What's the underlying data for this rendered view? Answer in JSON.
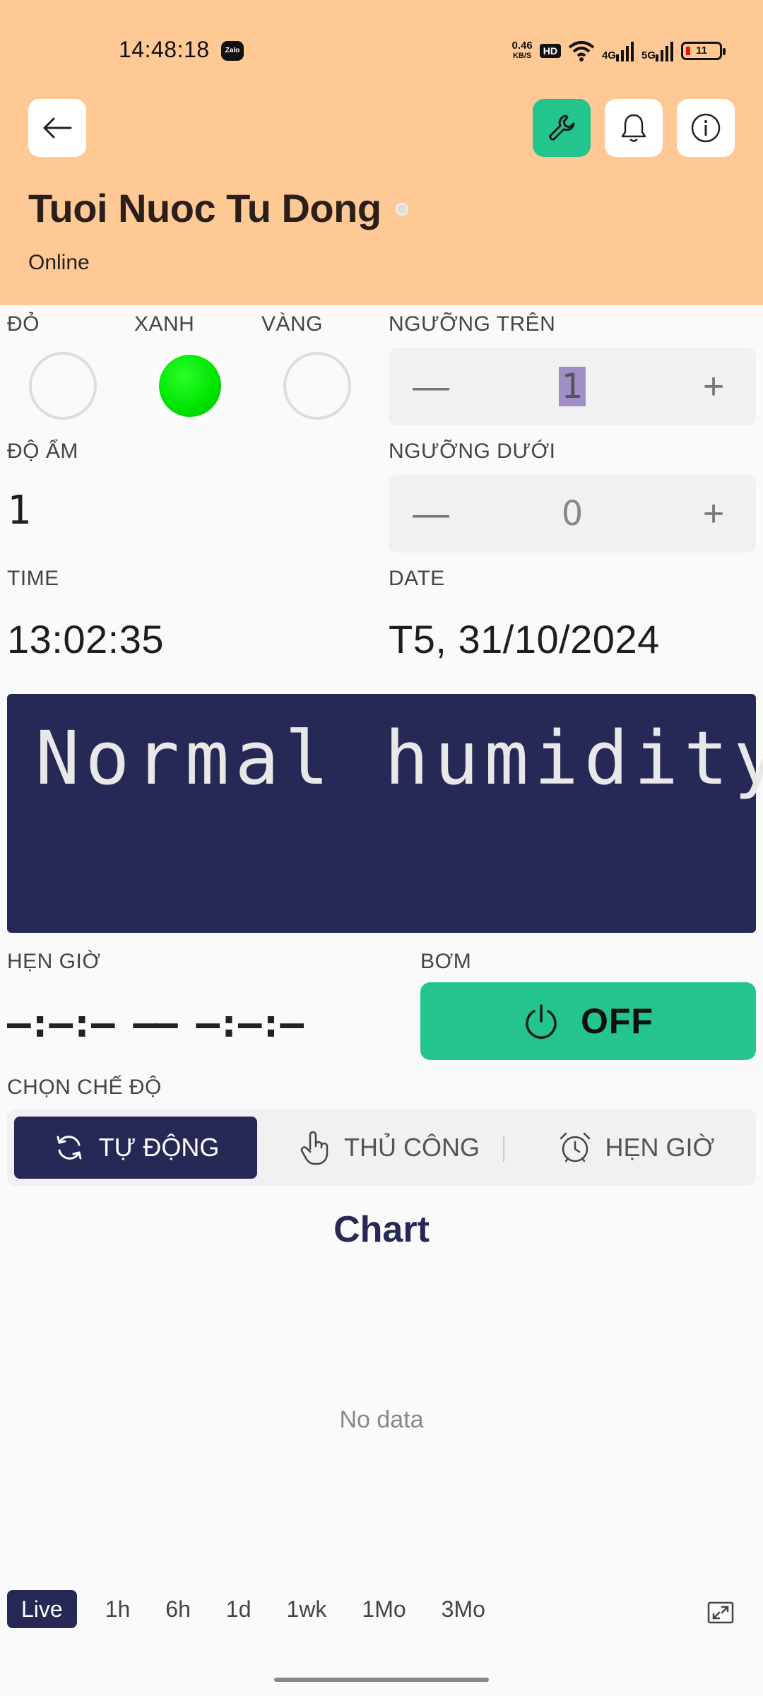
{
  "status_bar": {
    "time": "14:48:18",
    "net_speed_value": "0.46",
    "net_speed_unit": "KB/S",
    "hd_badge": "HD",
    "sig1": "4G",
    "sig2": "5G",
    "battery": "11"
  },
  "header": {
    "title": "Tuoi Nuoc Tu Dong",
    "status": "Online",
    "bg_color": "#ffc995",
    "accent_color": "#23c48e"
  },
  "leds": {
    "red_label": "ĐỎ",
    "green_label": "XANH",
    "yellow_label": "VÀNG",
    "active": "green"
  },
  "upper_threshold": {
    "label": "NGƯỠNG TRÊN",
    "value": "1",
    "minus": "—",
    "plus": "+"
  },
  "humidity": {
    "label": "ĐỘ ẨM",
    "value": "1"
  },
  "lower_threshold": {
    "label": "NGƯỠNG DƯỚI",
    "value": "0",
    "minus": "—",
    "plus": "+"
  },
  "time_widget": {
    "label": "TIME",
    "value": "13:02:35"
  },
  "date_widget": {
    "label": "DATE",
    "value": "T5, 31/10/2024"
  },
  "lcd": {
    "line1": "Normal humidity",
    "bg_color": "#262856"
  },
  "timer": {
    "label": "HẸN GIỜ",
    "value": "–:–:– –– –:–:–"
  },
  "pump": {
    "label": "BƠM",
    "button_label": "OFF"
  },
  "mode": {
    "label": "CHỌN CHẾ ĐỘ",
    "options": [
      "TỰ ĐỘNG",
      "THỦ CÔNG",
      "HẸN GIỜ"
    ],
    "selected": "TỰ ĐỘNG"
  },
  "chart": {
    "title": "Chart",
    "empty_text": "No data",
    "ranges": [
      "Live",
      "1h",
      "6h",
      "1d",
      "1wk",
      "1Mo",
      "3Mo"
    ],
    "selected_range": "Live"
  }
}
